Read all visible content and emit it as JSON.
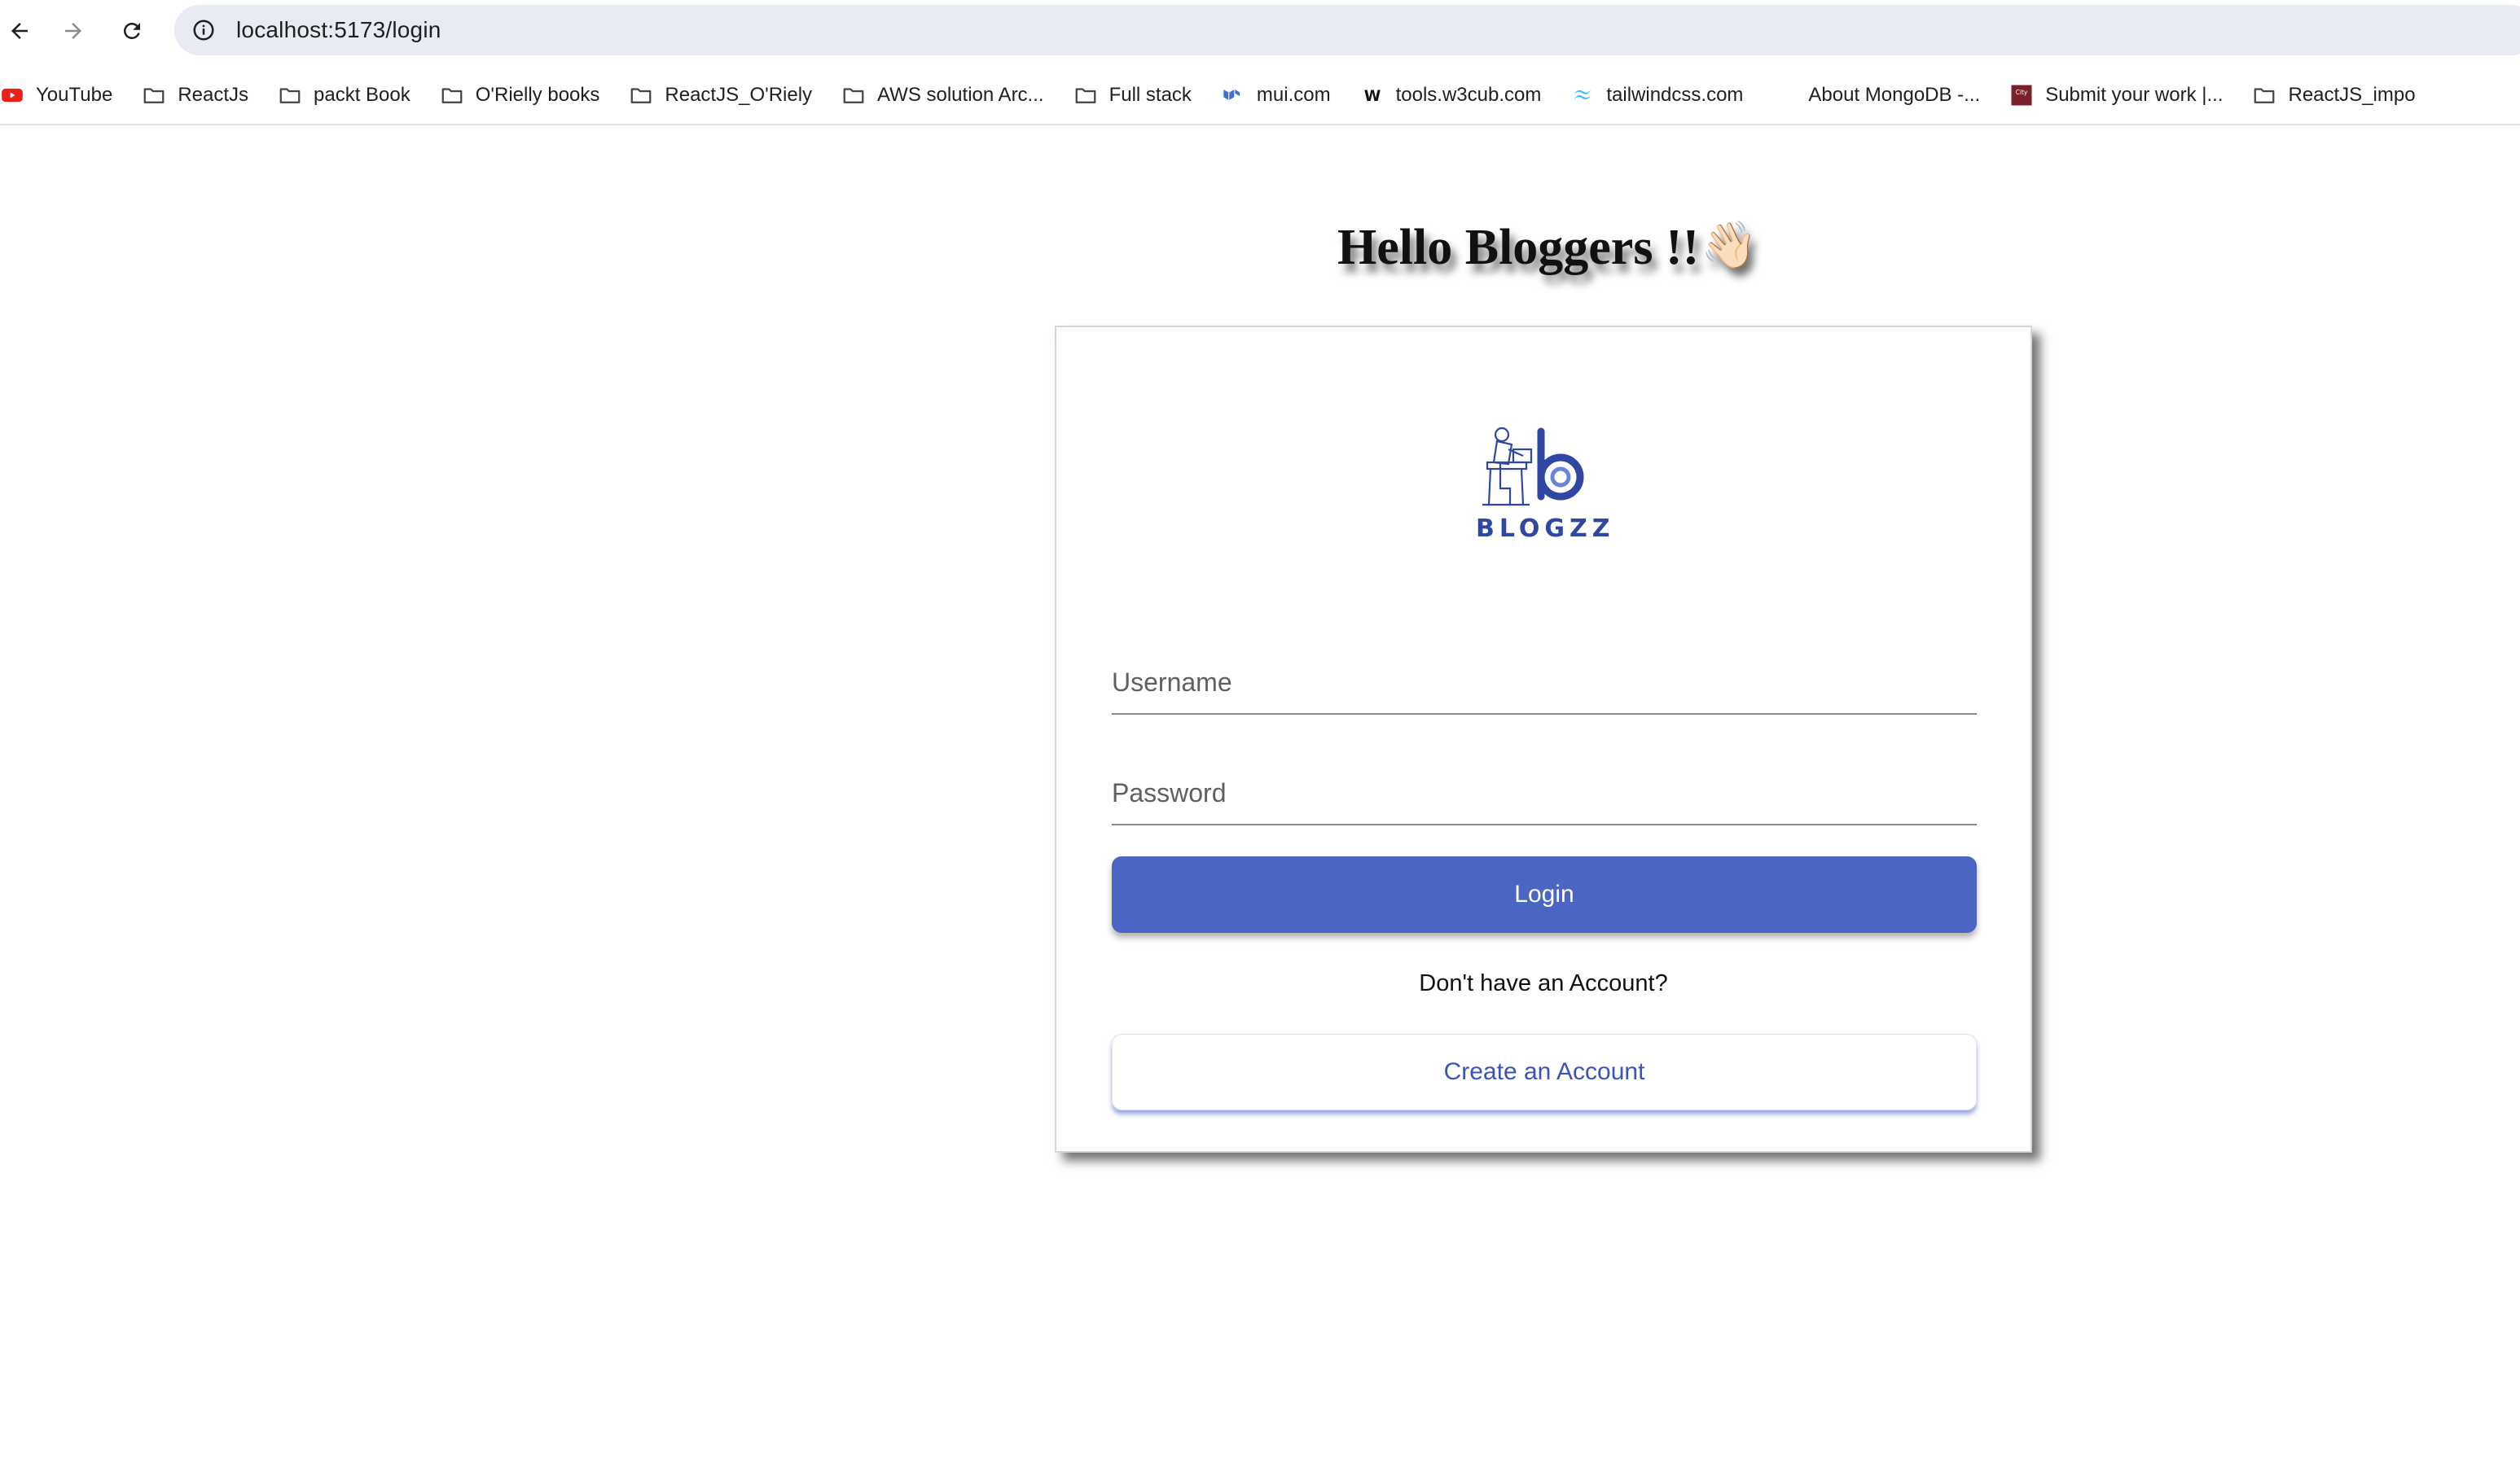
{
  "browser": {
    "url": "localhost:5173/login",
    "bookmarks": [
      {
        "label": "YouTube",
        "icon": "youtube-icon"
      },
      {
        "label": "ReactJs",
        "icon": "folder-icon"
      },
      {
        "label": "packt Book",
        "icon": "folder-icon"
      },
      {
        "label": "O'Rielly books",
        "icon": "folder-icon"
      },
      {
        "label": "ReactJS_O'Riely",
        "icon": "folder-icon"
      },
      {
        "label": "AWS solution Arc...",
        "icon": "folder-icon"
      },
      {
        "label": "Full stack",
        "icon": "folder-icon"
      },
      {
        "label": "mui.com",
        "icon": "mui-icon"
      },
      {
        "label": "tools.w3cub.com",
        "icon": "w3cub-icon"
      },
      {
        "label": "tailwindcss.com",
        "icon": "tailwind-icon"
      },
      {
        "label": "About MongoDB -...",
        "icon": "blank-icon"
      },
      {
        "label": "Submit your work |...",
        "icon": "cityu-icon"
      },
      {
        "label": "ReactJS_impo",
        "icon": "folder-icon"
      }
    ]
  },
  "page": {
    "heading": "Hello Bloggers !!",
    "heading_emoji": "👋🏻"
  },
  "login_card": {
    "logo_text": "BLOGZZ",
    "username_placeholder": "Username",
    "password_placeholder": "Password",
    "login_label": "Login",
    "no_account_text": "Don't have an Account?",
    "create_account_label": "Create an Account"
  },
  "colors": {
    "primary": "#4a65c4",
    "logo_blue": "#2f46a3",
    "omnibox_bg": "#e8ebf3",
    "youtube_red": "#e62117"
  }
}
